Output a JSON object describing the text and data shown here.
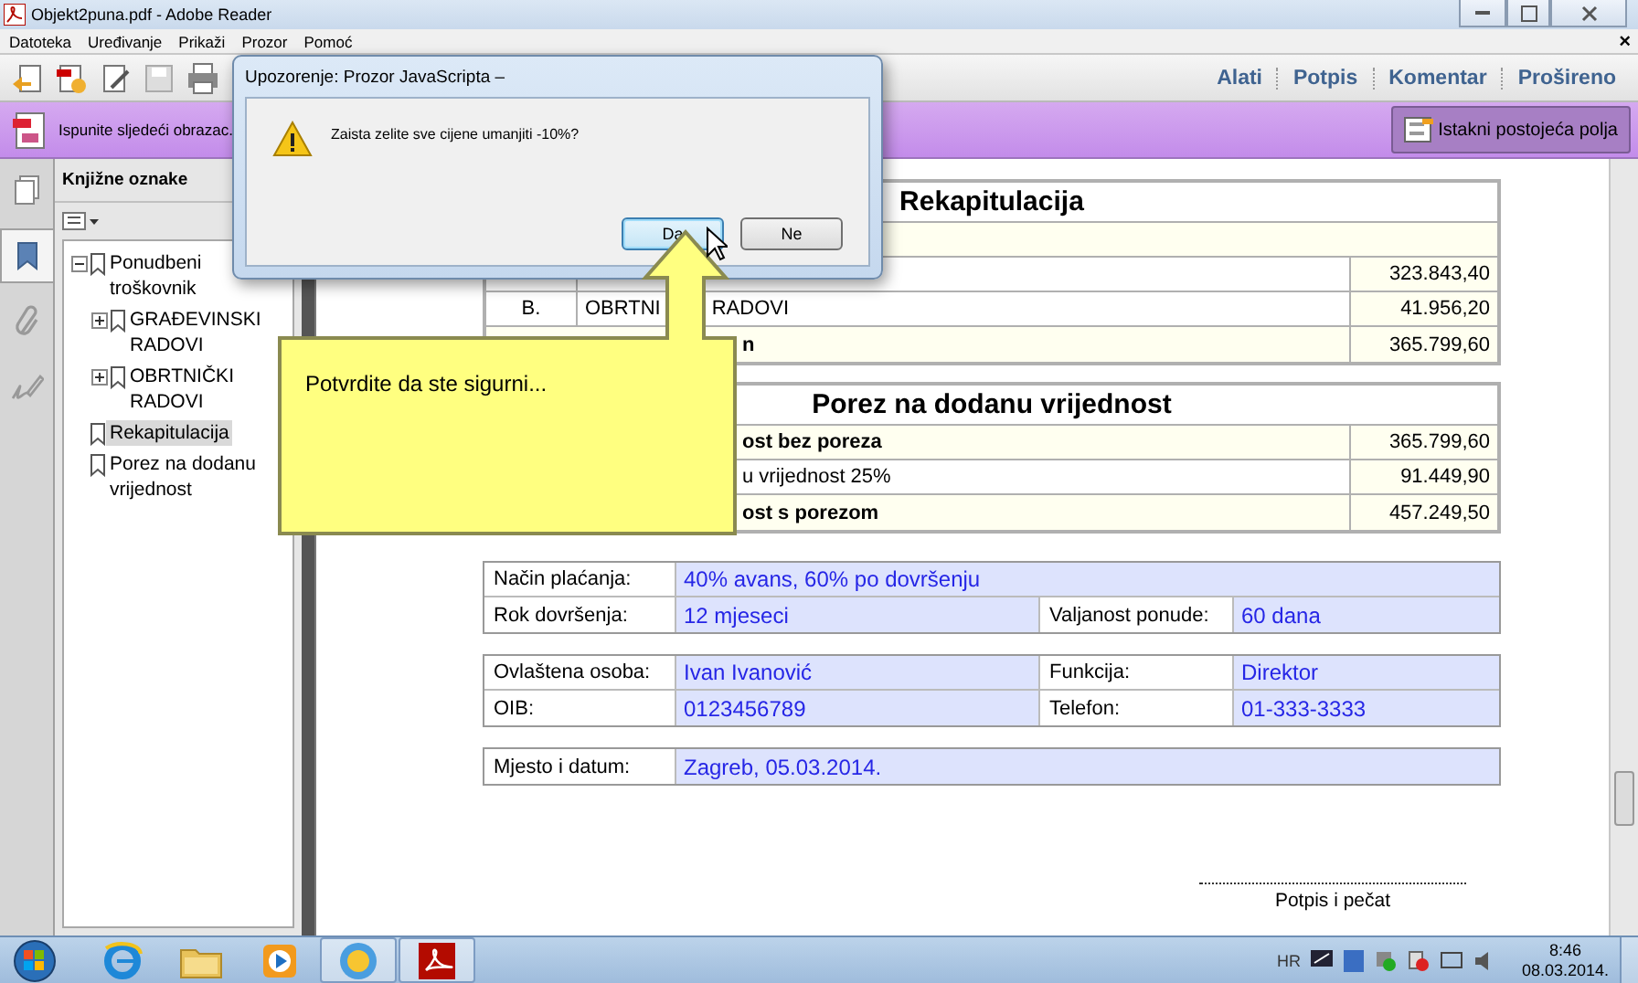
{
  "window": {
    "title": "Objekt2puna.pdf - Adobe Reader"
  },
  "menu": [
    "Datoteka",
    "Uređivanje",
    "Prikaži",
    "Prozor",
    "Pomoć"
  ],
  "menu_close": "×",
  "toolbar_tabs": [
    "Alati",
    "Potpis",
    "Komentar",
    "Prošireno"
  ],
  "form_bar": {
    "message": "Ispunite sljedeći obrazac.",
    "button": "Istakni postojeća polja"
  },
  "side_rail": [
    {
      "kind": "pages",
      "selected": false
    },
    {
      "kind": "bookmarks",
      "selected": true
    },
    {
      "kind": "attachments",
      "selected": false
    },
    {
      "kind": "signatures",
      "selected": false
    }
  ],
  "bookmarks": {
    "title": "Knjižne oznake",
    "items": [
      {
        "label": "Ponudbeni troškovnik",
        "selected": false,
        "expanded": true,
        "children": [
          {
            "label": "GRAĐEVINSKI RADOVI",
            "selected": false,
            "expanded": false
          },
          {
            "label": "OBRTNIČKI RADOVI",
            "selected": false,
            "expanded": false
          }
        ]
      },
      {
        "label": "Rekapitulacija",
        "selected": true
      },
      {
        "label": "Porez na dodanu vrijednost",
        "selected": false
      }
    ]
  },
  "recap": {
    "title": "Rekapitulacija",
    "rows": [
      {
        "kind": "item",
        "number": "",
        "label": "",
        "label_after_callout": "",
        "value": "323.843,40"
      },
      {
        "kind": "item",
        "number": "B.",
        "label": "OBRTNI",
        "label_after_callout": "RADOVI",
        "value": "41.956,20"
      },
      {
        "kind": "total",
        "number": "",
        "label": "",
        "label_after_callout": "n",
        "value": "365.799,60"
      }
    ]
  },
  "vat": {
    "title": "Porez na dodanu vrijednost",
    "rows": [
      {
        "kind": "total",
        "label": "ost bez poreza",
        "value": "365.799,60"
      },
      {
        "kind": "item",
        "label": "u vrijednost 25%",
        "value": "91.449,90"
      },
      {
        "kind": "total",
        "label": "ost s porezom",
        "value": "457.249,50"
      }
    ]
  },
  "form_tables": [
    [
      [
        {
          "label": "Način plaćanja:",
          "value": "40% avans, 60% po dovršenju"
        }
      ],
      [
        {
          "label": "Rok dovršenja:",
          "value": "12 mjeseci"
        },
        {
          "label": "Valjanost ponude:",
          "value": "60 dana"
        }
      ]
    ],
    [
      [
        {
          "label": "Ovlaštena osoba:",
          "value": "Ivan Ivanović"
        },
        {
          "label": "Funkcija:",
          "value": "Direktor"
        }
      ],
      [
        {
          "label": "OIB:",
          "value": "0123456789"
        },
        {
          "label": "Telefon:",
          "value": "01-333-3333"
        }
      ]
    ],
    [
      [
        {
          "label": "Mjesto i datum:",
          "value": "Zagreb, 05.03.2014."
        }
      ]
    ]
  ],
  "signature_label": "Potpis i pečat",
  "dialog": {
    "title": "Upozorenje: Prozor JavaScripta –",
    "message": "Zaista zelite sve cijene umanjiti -10%?",
    "buttons": [
      {
        "label": "Da",
        "default": true
      },
      {
        "label": "Ne",
        "default": false
      }
    ]
  },
  "callout": {
    "text": "Potvrdite da ste sigurni..."
  },
  "taskbar": {
    "apps": [
      {
        "kind": "ie",
        "active": false
      },
      {
        "kind": "folder",
        "active": false
      },
      {
        "kind": "media",
        "active": false
      },
      {
        "kind": "clock",
        "active": true
      },
      {
        "kind": "pdf",
        "active": true
      }
    ],
    "language": "HR",
    "time": "8:46",
    "date": "08.03.2014."
  }
}
